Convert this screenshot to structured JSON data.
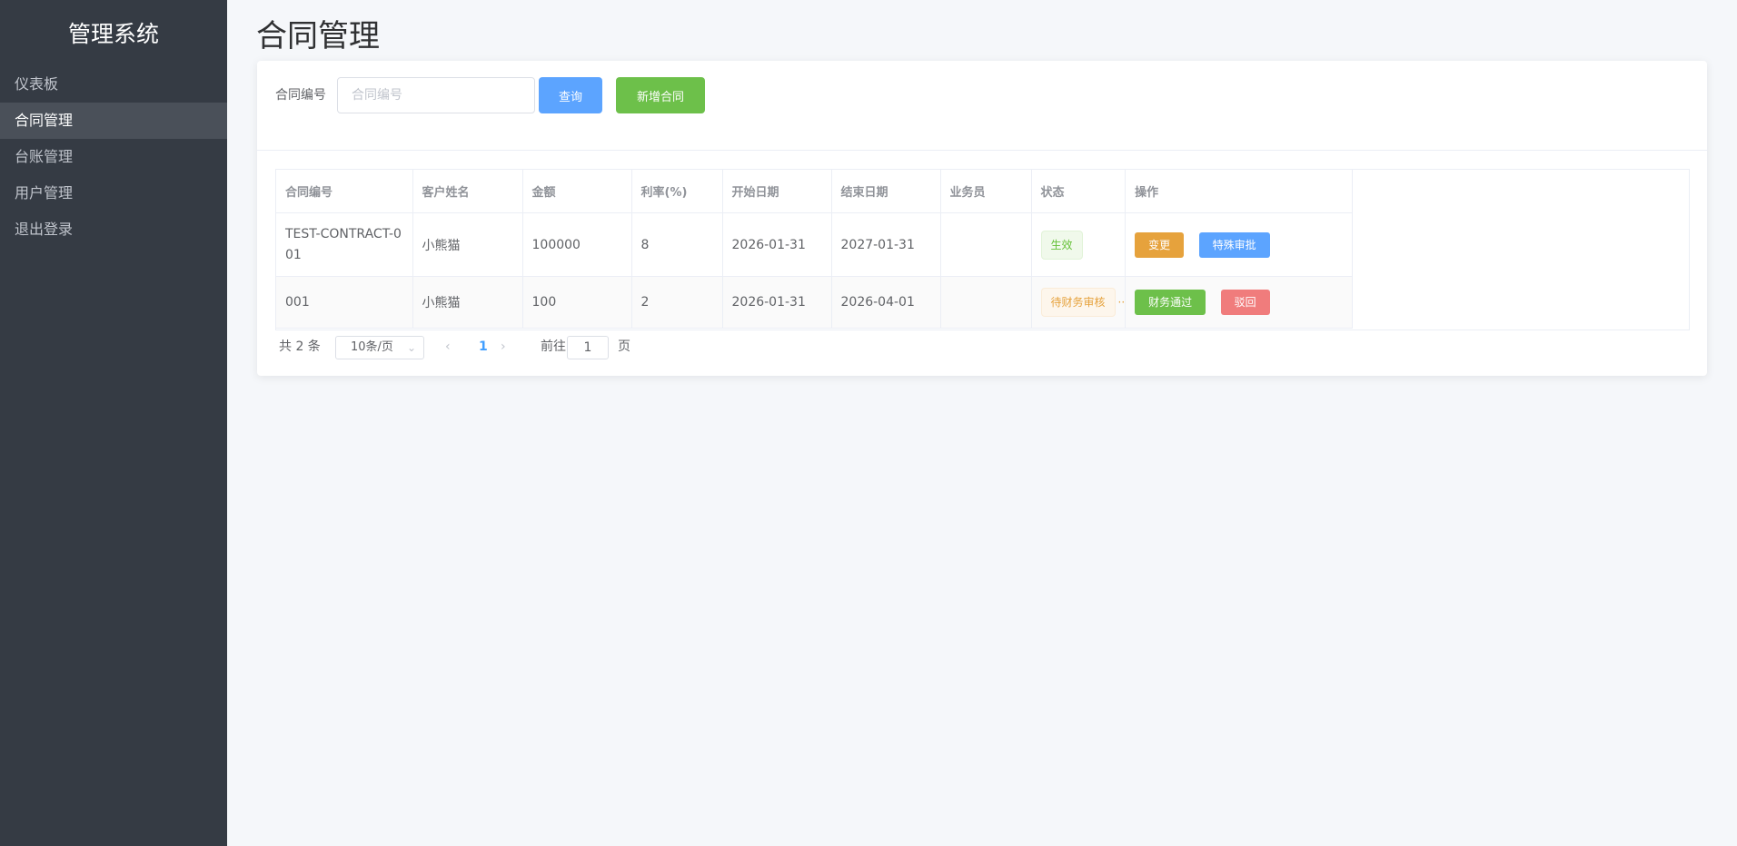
{
  "sidebar": {
    "title": "管理系统",
    "items": [
      {
        "label": "仪表板",
        "active": false
      },
      {
        "label": "合同管理",
        "active": true
      },
      {
        "label": "台账管理",
        "active": false
      },
      {
        "label": "用户管理",
        "active": false
      },
      {
        "label": "退出登录",
        "active": false
      }
    ]
  },
  "page": {
    "title": "合同管理"
  },
  "search": {
    "label": "合同编号",
    "placeholder": "合同编号",
    "value": "",
    "query_button": "查询",
    "add_button": "新增合同"
  },
  "table": {
    "columns": [
      "合同编号",
      "客户姓名",
      "金额",
      "利率(%)",
      "开始日期",
      "结束日期",
      "业务员",
      "状态",
      "操作"
    ],
    "rows": [
      {
        "contract_no": "TEST-CONTRACT-001",
        "customer": "小熊猫",
        "amount": "100000",
        "rate": "8",
        "start": "2026-01-31",
        "end": "2027-01-31",
        "salesman": "",
        "status": "生效",
        "actions": [
          "变更",
          "特殊审批"
        ]
      },
      {
        "contract_no": "001",
        "customer": "小熊猫",
        "amount": "100",
        "rate": "2",
        "start": "2026-01-31",
        "end": "2026-04-01",
        "salesman": "",
        "status": "待财务审核",
        "status_overflow": "··",
        "actions": [
          "财务通过",
          "驳回"
        ]
      }
    ]
  },
  "pagination": {
    "total_text": "共 2 条",
    "page_size": "10条/页",
    "current_page": "1",
    "goto_label": "前往",
    "goto_value": "1",
    "page_suffix": "页"
  },
  "colors": {
    "sidebar_bg": "#353b44",
    "active_menu_bg": "#4a5059",
    "primary": "#5ca4ff",
    "success": "#6dc04a",
    "warning": "#e6a23c",
    "danger": "#f07c7c"
  }
}
